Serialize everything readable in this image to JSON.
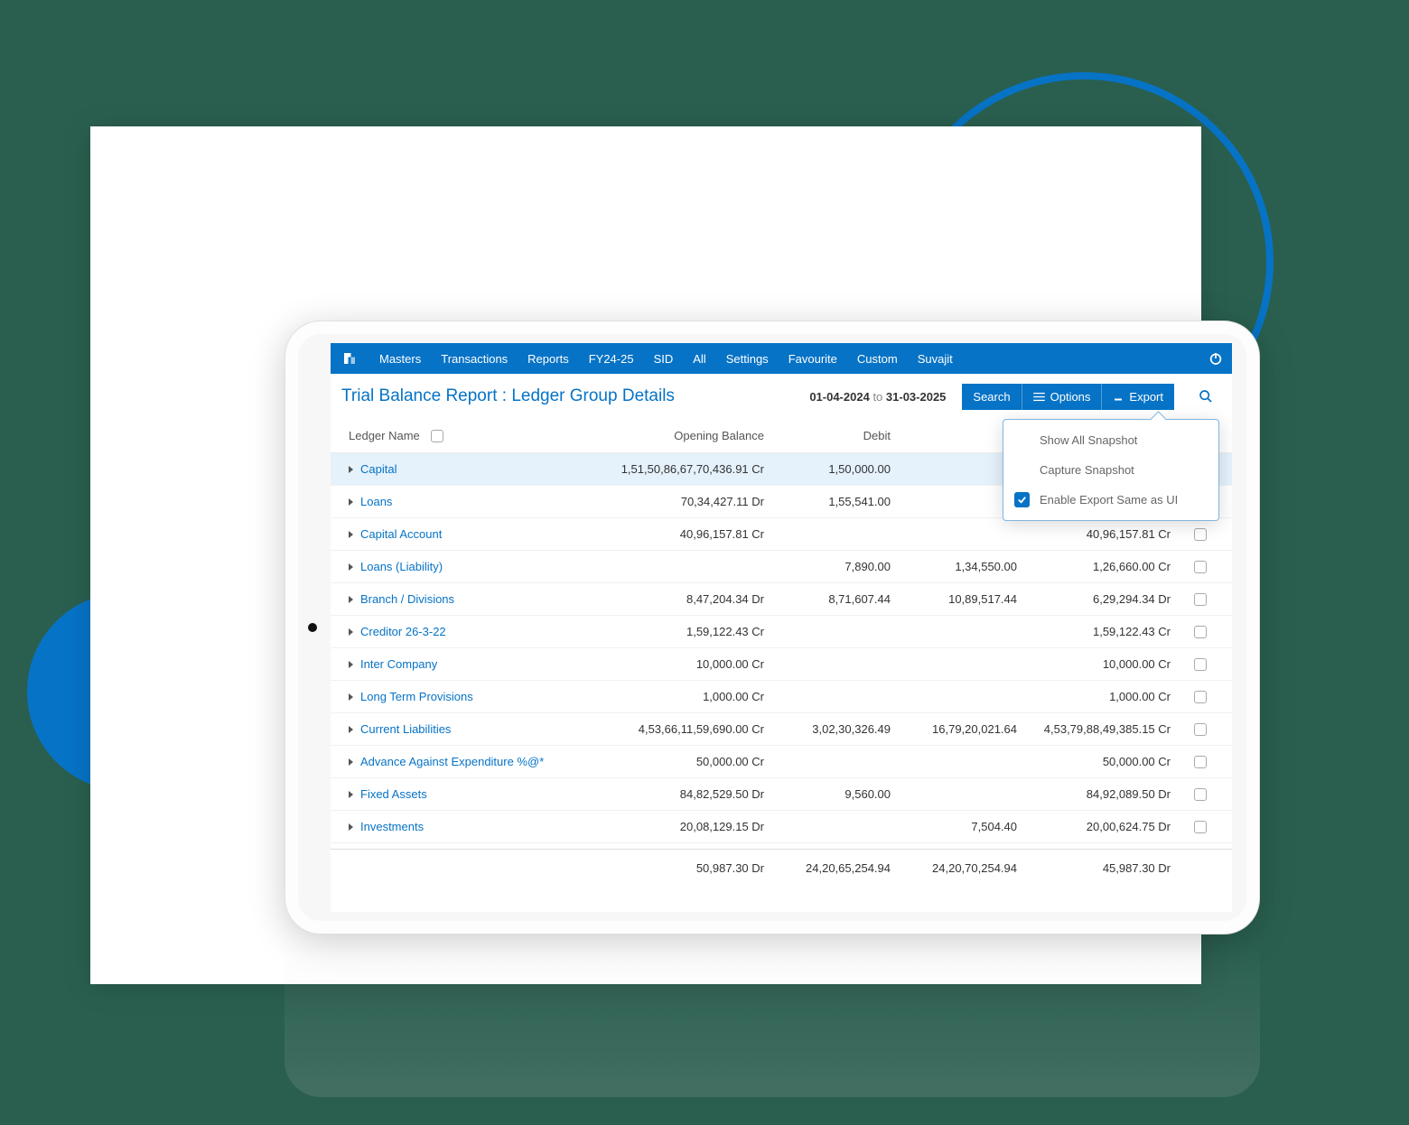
{
  "colors": {
    "primary": "#0673c6",
    "bg": "#2a5f4f"
  },
  "topnav": {
    "items": [
      "Masters",
      "Transactions",
      "Reports",
      "FY24-25",
      "SID",
      "All",
      "Settings",
      "Favourite",
      "Custom",
      "Suvajit"
    ]
  },
  "header": {
    "title": "Trial Balance Report : Ledger Group Details",
    "date_from": "01-04-2024",
    "date_sep": "to",
    "date_to": "31-03-2025",
    "search_label": "Search",
    "options_label": "Options",
    "export_label": "Export"
  },
  "columns": {
    "ledger_name": "Ledger Name",
    "opening_balance": "Opening Balance",
    "debit": "Debit"
  },
  "dropdown": {
    "items": [
      {
        "label": "Show All Snapshot",
        "checked": false
      },
      {
        "label": "Capture Snapshot",
        "checked": false
      },
      {
        "label": "Enable Export Same as UI",
        "checked": true
      }
    ]
  },
  "rows": [
    {
      "name": "Capital",
      "opening": "1,51,50,86,67,70,436.91 Cr",
      "debit": "1,50,000.00",
      "credit": "",
      "closing": "",
      "selected": true
    },
    {
      "name": "Loans",
      "opening": "70,34,427.11 Dr",
      "debit": "1,55,541.00",
      "credit": "",
      "closing": ""
    },
    {
      "name": "Capital Account",
      "opening": "40,96,157.81 Cr",
      "debit": "",
      "credit": "",
      "closing": "40,96,157.81 Cr"
    },
    {
      "name": "Loans (Liability)",
      "opening": "",
      "debit": "7,890.00",
      "credit": "1,34,550.00",
      "closing": "1,26,660.00 Cr"
    },
    {
      "name": "Branch / Divisions",
      "opening": "8,47,204.34 Dr",
      "debit": "8,71,607.44",
      "credit": "10,89,517.44",
      "closing": "6,29,294.34 Dr"
    },
    {
      "name": "Creditor 26-3-22",
      "opening": "1,59,122.43 Cr",
      "debit": "",
      "credit": "",
      "closing": "1,59,122.43 Cr"
    },
    {
      "name": "Inter Company",
      "opening": "10,000.00 Cr",
      "debit": "",
      "credit": "",
      "closing": "10,000.00 Cr"
    },
    {
      "name": "Long Term Provisions",
      "opening": "1,000.00 Cr",
      "debit": "",
      "credit": "",
      "closing": "1,000.00 Cr"
    },
    {
      "name": "Current Liabilities",
      "opening": "4,53,66,11,59,690.00 Cr",
      "debit": "3,02,30,326.49",
      "credit": "16,79,20,021.64",
      "closing": "4,53,79,88,49,385.15 Cr"
    },
    {
      "name": "Advance Against Expenditure %@*",
      "opening": "50,000.00 Cr",
      "debit": "",
      "credit": "",
      "closing": "50,000.00 Cr"
    },
    {
      "name": "Fixed Assets",
      "opening": "84,82,529.50 Dr",
      "debit": "9,560.00",
      "credit": "",
      "closing": "84,92,089.50 Dr"
    },
    {
      "name": "Investments",
      "opening": "20,08,129.15 Dr",
      "debit": "",
      "credit": "7,504.40",
      "closing": "20,00,624.75 Dr"
    }
  ],
  "totals": {
    "opening": "50,987.30 Dr",
    "debit": "24,20,65,254.94",
    "credit": "24,20,70,254.94",
    "closing": "45,987.30 Dr"
  }
}
